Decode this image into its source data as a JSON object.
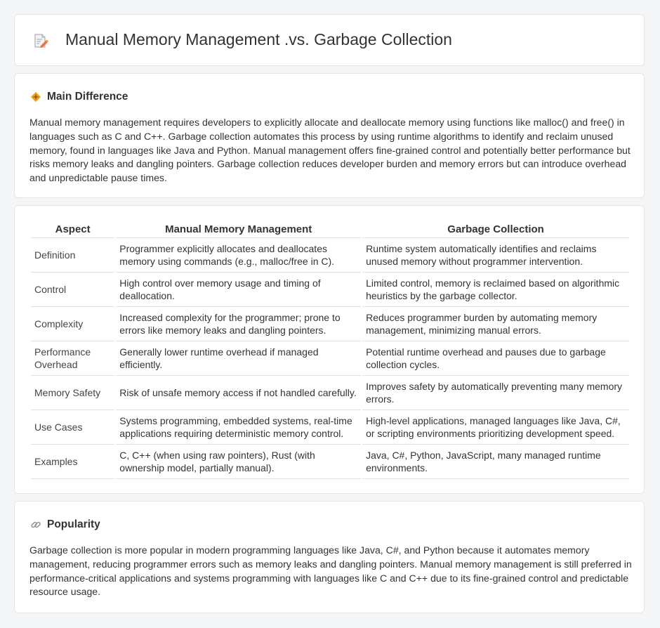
{
  "header": {
    "title": "Manual Memory Management .vs. Garbage Collection",
    "icon": "document-pencil-icon"
  },
  "main_difference": {
    "heading": "Main Difference",
    "icon": "diamond-icon",
    "text": "Manual memory management requires developers to explicitly allocate and deallocate memory using functions like malloc() and free() in languages such as C and C++. Garbage collection automates this process by using runtime algorithms to identify and reclaim unused memory, found in languages like Java and Python. Manual management offers fine-grained control and potentially better performance but risks memory leaks and dangling pointers. Garbage collection reduces developer burden and memory errors but can introduce overhead and unpredictable pause times."
  },
  "comparison": {
    "headers": [
      "Aspect",
      "Manual Memory Management",
      "Garbage Collection"
    ],
    "rows": [
      {
        "aspect": "Definition",
        "manual": "Programmer explicitly allocates and deallocates memory using commands (e.g., malloc/free in C).",
        "gc": "Runtime system automatically identifies and reclaims unused memory without programmer intervention."
      },
      {
        "aspect": "Control",
        "manual": "High control over memory usage and timing of deallocation.",
        "gc": "Limited control, memory is reclaimed based on algorithmic heuristics by the garbage collector."
      },
      {
        "aspect": "Complexity",
        "manual": "Increased complexity for the programmer; prone to errors like memory leaks and dangling pointers.",
        "gc": "Reduces programmer burden by automating memory management, minimizing manual errors."
      },
      {
        "aspect": "Performance Overhead",
        "manual": "Generally lower runtime overhead if managed efficiently.",
        "gc": "Potential runtime overhead and pauses due to garbage collection cycles."
      },
      {
        "aspect": "Memory Safety",
        "manual": "Risk of unsafe memory access if not handled carefully.",
        "gc": "Improves safety by automatically preventing many memory errors."
      },
      {
        "aspect": "Use Cases",
        "manual": "Systems programming, embedded systems, real-time applications requiring deterministic memory control.",
        "gc": "High-level applications, managed languages like Java, C#, or scripting environments prioritizing development speed."
      },
      {
        "aspect": "Examples",
        "manual": "C, C++ (when using raw pointers), Rust (with ownership model, partially manual).",
        "gc": "Java, C#, Python, JavaScript, many managed runtime environments."
      }
    ]
  },
  "popularity": {
    "heading": "Popularity",
    "icon": "link-icon",
    "text": "Garbage collection is more popular in modern programming languages like Java, C#, and Python because it automates memory management, reducing programmer errors such as memory leaks and dangling pointers. Manual memory management is still preferred in performance-critical applications and systems programming with languages like C and C++ due to its fine-grained control and predictable resource usage."
  }
}
